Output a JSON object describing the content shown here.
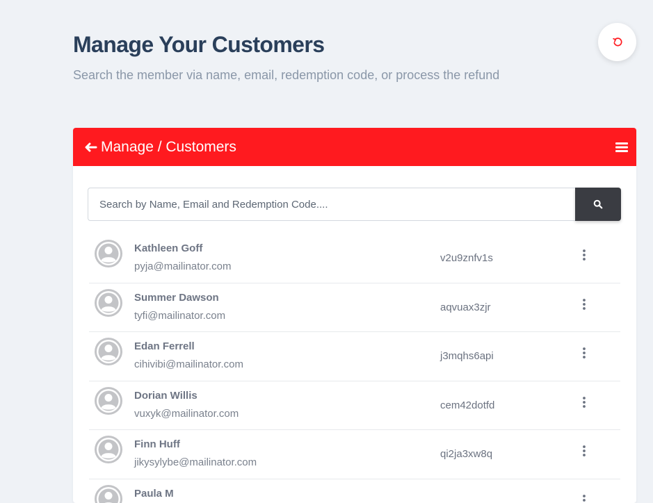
{
  "page": {
    "title": "Manage Your Customers",
    "subtitle": "Search the member via name, email, redemption code, or process the refund"
  },
  "icons": {
    "refresh": "refresh-icon",
    "back": "arrow-left-icon",
    "menu": "hamburger-menu-icon",
    "search": "search-icon",
    "avatar": "user-avatar-icon",
    "more": "more-vertical-icon"
  },
  "colors": {
    "accent": "#ff1a1f",
    "title": "#2a3f5a",
    "search_button": "#3a3c42"
  },
  "card": {
    "title": "Manage / Customers"
  },
  "search": {
    "placeholder": "Search by Name, Email and Redemption Code....",
    "value": ""
  },
  "customers": [
    {
      "name": "Kathleen Goff",
      "email": "pyja@mailinator.com",
      "code": "v2u9znfv1s"
    },
    {
      "name": "Summer Dawson",
      "email": "tyfi@mailinator.com",
      "code": "aqvuax3zjr"
    },
    {
      "name": "Edan Ferrell",
      "email": "cihivibi@mailinator.com",
      "code": "j3mqhs6api"
    },
    {
      "name": "Dorian Willis",
      "email": "vuxyk@mailinator.com",
      "code": "cem42dotfd"
    },
    {
      "name": "Finn Huff",
      "email": "jikysylybe@mailinator.com",
      "code": "qi2ja3xw8q"
    },
    {
      "name": "Paula M",
      "email": "",
      "code": ""
    }
  ]
}
